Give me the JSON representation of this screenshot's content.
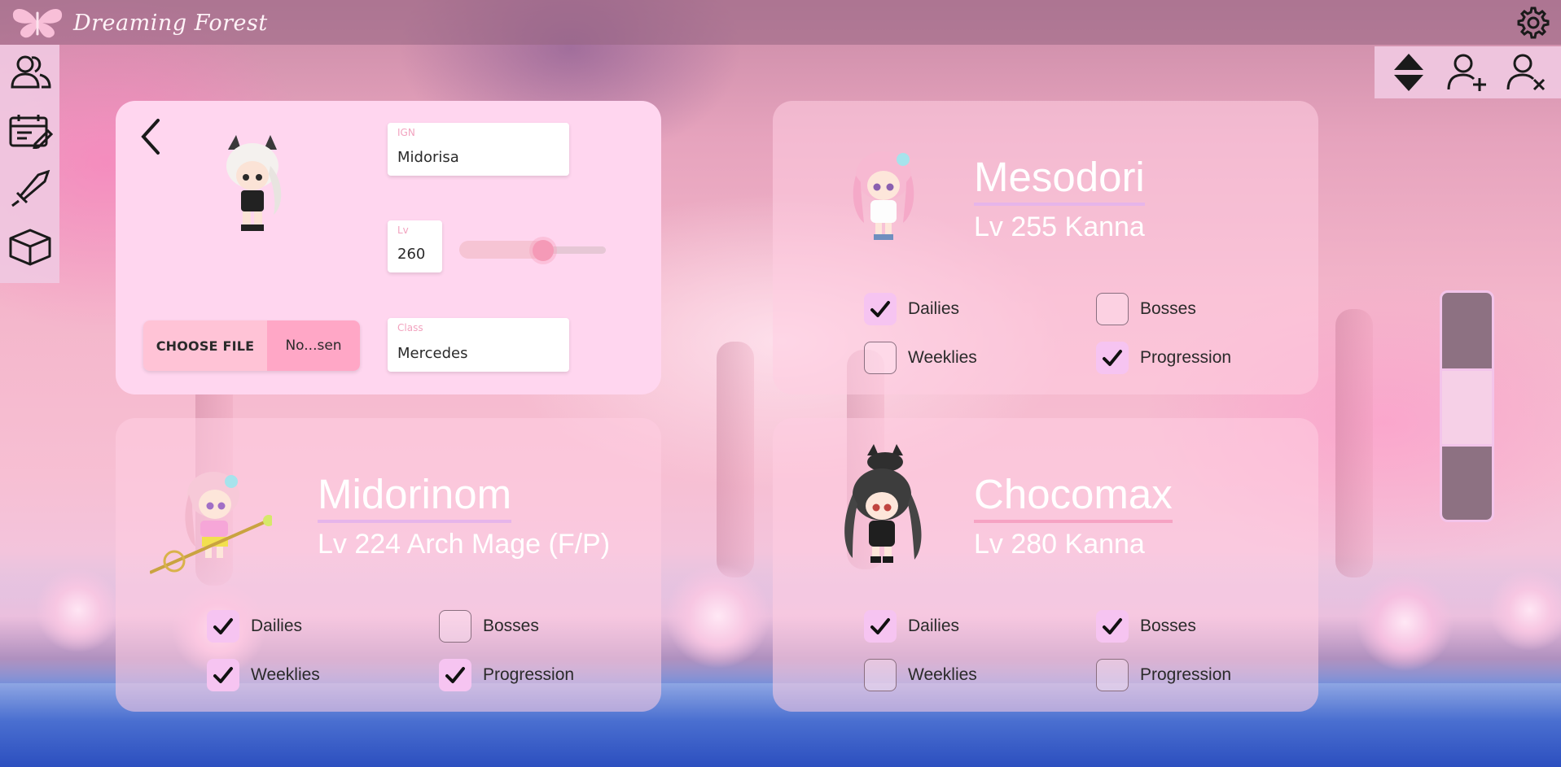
{
  "app": {
    "title": "Dreaming Forest"
  },
  "colors": {
    "accent": "#f6c4f1",
    "card": "#ffd6ef",
    "nav": "#f0c8e1"
  },
  "nav": {
    "items": [
      {
        "icon": "characters-icon"
      },
      {
        "icon": "tasks-icon"
      },
      {
        "icon": "sword-icon"
      },
      {
        "icon": "box-icon"
      }
    ]
  },
  "toolbar": {
    "icons": [
      "sort-icon",
      "add-user-icon",
      "remove-user-icon",
      "settings-icon"
    ]
  },
  "editor": {
    "ign": {
      "label": "IGN",
      "value": "Midorisa"
    },
    "level": {
      "label": "Lv",
      "value": "260",
      "slider_fraction": 0.57
    },
    "class": {
      "label": "Class",
      "value": "Mercedes"
    },
    "file": {
      "button": "CHOOSE FILE",
      "name": "No...sen"
    }
  },
  "characters": [
    {
      "name": "Mesodori",
      "subtitle": "Lv 255 Kanna",
      "tasks": [
        {
          "label": "Dailies",
          "checked": true
        },
        {
          "label": "Bosses",
          "checked": false
        },
        {
          "label": "Weeklies",
          "checked": false
        },
        {
          "label": "Progression",
          "checked": true
        }
      ]
    },
    {
      "name": "Midorinom",
      "subtitle": "Lv 224 Arch Mage (F/P)",
      "tasks": [
        {
          "label": "Dailies",
          "checked": true
        },
        {
          "label": "Bosses",
          "checked": false
        },
        {
          "label": "Weeklies",
          "checked": true
        },
        {
          "label": "Progression",
          "checked": true
        }
      ]
    },
    {
      "name": "Chocomax",
      "subtitle": "Lv 280 Kanna",
      "tasks": [
        {
          "label": "Dailies",
          "checked": true
        },
        {
          "label": "Bosses",
          "checked": true
        },
        {
          "label": "Weeklies",
          "checked": false
        },
        {
          "label": "Progression",
          "checked": false
        }
      ]
    }
  ],
  "page_scroller": {
    "segments": 3,
    "active_segment": 2
  }
}
